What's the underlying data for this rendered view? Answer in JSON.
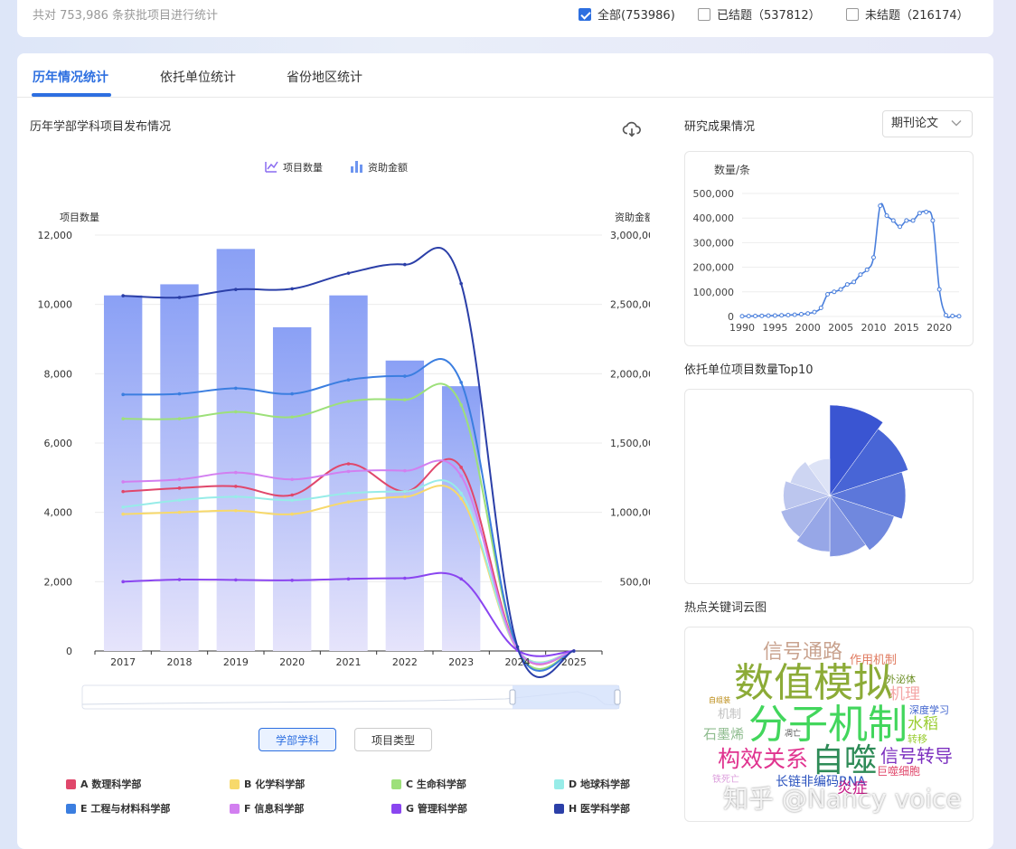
{
  "header": {
    "summary": "共对 753,986 条获批项目进行统计",
    "filters": [
      {
        "label": "全部(753986)",
        "checked": true
      },
      {
        "label": "已结题（537812）",
        "checked": false
      },
      {
        "label": "未结题（216174）",
        "checked": false
      }
    ]
  },
  "tabs": [
    "历年情况统计",
    "依托单位统计",
    "省份地区统计"
  ],
  "main_chart": {
    "title": "历年学部学科项目发布情况",
    "legend_top": [
      "项目数量",
      "资助金额"
    ],
    "y_left_label": "项目数量",
    "y_right_label": "资助金额",
    "y_left_ticks": [
      "12,000",
      "10,000",
      "8,000",
      "6,000",
      "4,000",
      "2,000",
      "0"
    ],
    "y_right_ticks": [
      "3,000,000",
      "2,500,000",
      "2,000,000",
      "1,500,000",
      "1,000,000",
      "500,000",
      "0"
    ],
    "x_ticks": [
      "2017",
      "2018",
      "2019",
      "2020",
      "2021",
      "2022",
      "2023",
      "2024",
      "2025"
    ],
    "toggle_buttons": [
      "学部学科",
      "项目类型"
    ],
    "series_legend": [
      {
        "name": "A 数理科学部",
        "color": "#e0476b"
      },
      {
        "name": "B 化学科学部",
        "color": "#f7d96b"
      },
      {
        "name": "C 生命科学部",
        "color": "#9de07a"
      },
      {
        "name": "D 地球科学部",
        "color": "#97ece8"
      },
      {
        "name": "E 工程与材料科学部",
        "color": "#3b7ee0"
      },
      {
        "name": "F 信息科学部",
        "color": "#d27ff0"
      },
      {
        "name": "G 管理科学部",
        "color": "#8a45f0"
      },
      {
        "name": "H 医学科学部",
        "color": "#2b3fa8"
      }
    ]
  },
  "chart_data": [
    {
      "type": "bar",
      "title": "历年学部学科项目发布情况",
      "categories": [
        "2017",
        "2018",
        "2019",
        "2020",
        "2021",
        "2022",
        "2023",
        "2024",
        "2025"
      ],
      "ylabel": "资助金额",
      "ylim": [
        0,
        3000000
      ],
      "series": [
        {
          "name": "资助金额",
          "values": [
            2565000,
            2645000,
            2900000,
            2335000,
            2565000,
            2095000,
            1910000,
            0,
            0
          ]
        }
      ]
    },
    {
      "type": "line",
      "categories": [
        "2017",
        "2018",
        "2019",
        "2020",
        "2021",
        "2022",
        "2023",
        "2024",
        "2025"
      ],
      "ylabel": "项目数量",
      "ylim": [
        0,
        12000
      ],
      "series": [
        {
          "name": "A 数理科学部",
          "color": "#e0476b",
          "values": [
            4600,
            4700,
            4750,
            4500,
            5400,
            4600,
            5300,
            50,
            0
          ]
        },
        {
          "name": "B 化学科学部",
          "color": "#f7d96b",
          "values": [
            3950,
            4000,
            4050,
            3950,
            4300,
            4450,
            4400,
            30,
            0
          ]
        },
        {
          "name": "C 生命科学部",
          "color": "#9de07a",
          "values": [
            6700,
            6700,
            6900,
            6750,
            7200,
            7250,
            7100,
            60,
            0
          ]
        },
        {
          "name": "D 地球科学部",
          "color": "#97ece8",
          "values": [
            4150,
            4350,
            4450,
            4350,
            4550,
            4600,
            4550,
            40,
            0
          ]
        },
        {
          "name": "E 工程与材料科学部",
          "color": "#3b7ee0",
          "values": [
            7400,
            7420,
            7580,
            7420,
            7820,
            7930,
            7750,
            60,
            0
          ]
        },
        {
          "name": "F 信息科学部",
          "color": "#d27ff0",
          "values": [
            4880,
            4950,
            5150,
            4950,
            5180,
            5200,
            5050,
            40,
            0
          ]
        },
        {
          "name": "G 管理科学部",
          "color": "#8a45f0",
          "values": [
            2000,
            2060,
            2050,
            2040,
            2080,
            2100,
            2080,
            20,
            0
          ]
        },
        {
          "name": "H 医学科学部",
          "color": "#2b3fa8",
          "values": [
            10250,
            10200,
            10430,
            10450,
            10900,
            11150,
            10600,
            120,
            0
          ]
        }
      ]
    },
    {
      "type": "line",
      "title": "研究成果情况",
      "ylabel": "数量/条",
      "ylim": [
        0,
        500000
      ],
      "x": [
        1990,
        1991,
        1992,
        1993,
        1994,
        1995,
        1996,
        1997,
        1998,
        1999,
        2000,
        2001,
        2002,
        2003,
        2004,
        2005,
        2006,
        2007,
        2008,
        2009,
        2010,
        2011,
        2012,
        2013,
        2014,
        2015,
        2016,
        2017,
        2018,
        2019,
        2020,
        2021,
        2022,
        2023
      ],
      "series": [
        {
          "name": "期刊论文",
          "values": [
            1000,
            1500,
            2000,
            2500,
            3000,
            3500,
            4500,
            5500,
            7000,
            9000,
            12000,
            18000,
            35000,
            90000,
            100000,
            110000,
            130000,
            140000,
            170000,
            190000,
            240000,
            450000,
            410000,
            390000,
            365000,
            390000,
            390000,
            420000,
            425000,
            390000,
            110000,
            5000,
            2000,
            1000
          ]
        }
      ]
    },
    {
      "type": "pie",
      "title": "依托单位项目数量Top10",
      "values": [
        100,
        90,
        82,
        72,
        64,
        58,
        52,
        46,
        40,
        34
      ]
    }
  ],
  "research": {
    "title": "研究成果情况",
    "select_value": "期刊论文",
    "ylabel": "数量/条",
    "y_ticks": [
      "500,000",
      "400,000",
      "300,000",
      "200,000",
      "100,000",
      "0"
    ],
    "x_ticks": [
      "1990",
      "1995",
      "2000",
      "2005",
      "2010",
      "2015",
      "2020"
    ]
  },
  "top10": {
    "title": "依托单位项目数量Top10"
  },
  "wordcloud": {
    "title": "热点关键词云图",
    "words": [
      {
        "text": "信号通路",
        "color": "#c9a38f"
      },
      {
        "text": "作用机制",
        "color": "#e07a5f"
      },
      {
        "text": "数值模拟",
        "color": "#8cab37"
      },
      {
        "text": "外泌体",
        "color": "#6b8e23"
      },
      {
        "text": "机理",
        "color": "#f4a6a6"
      },
      {
        "text": "自组装",
        "color": "#b8860b"
      },
      {
        "text": "深度学习",
        "color": "#3a5fcd"
      },
      {
        "text": "机制",
        "color": "#c0c0c0"
      },
      {
        "text": "分子机制",
        "color": "#42d65c"
      },
      {
        "text": "水稻",
        "color": "#9acd32"
      },
      {
        "text": "石墨烯",
        "color": "#8fbc8f"
      },
      {
        "text": "凋亡",
        "color": "#555555"
      },
      {
        "text": "转移",
        "color": "#9acd32"
      },
      {
        "text": "构效关系",
        "color": "#e0338f"
      },
      {
        "text": "自噬",
        "color": "#2e8b57"
      },
      {
        "text": "信号转导",
        "color": "#7b2fbf"
      },
      {
        "text": "巨噬细胞",
        "color": "#e0476b"
      },
      {
        "text": "铁死亡",
        "color": "#dda0dd"
      },
      {
        "text": "长链非编码RNA",
        "color": "#2a52be"
      },
      {
        "text": "炎症",
        "color": "#c71585"
      }
    ]
  },
  "watermark": "知乎 @Nancy voice"
}
